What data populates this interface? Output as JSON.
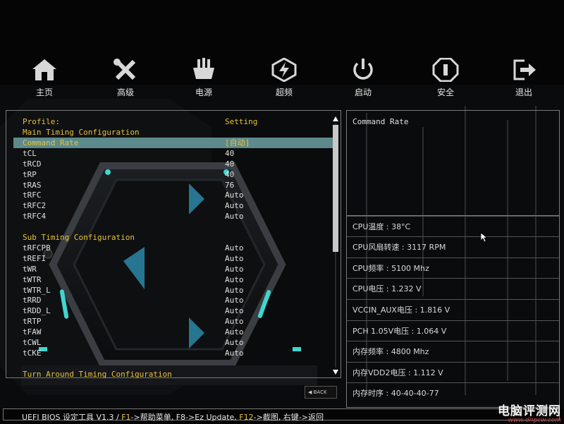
{
  "nav": [
    {
      "label": "主页",
      "icon": "home-icon"
    },
    {
      "label": "高级",
      "icon": "tools-icon"
    },
    {
      "label": "电源",
      "icon": "power-supply-icon"
    },
    {
      "label": "超频",
      "icon": "overclock-icon"
    },
    {
      "label": "启动",
      "icon": "boot-icon"
    },
    {
      "label": "安全",
      "icon": "security-icon"
    },
    {
      "label": "退出",
      "icon": "exit-icon"
    }
  ],
  "timing": {
    "profile_label": "Profile:",
    "profile_value": "Setting",
    "rows": [
      {
        "k": "Main Timing Configuration",
        "v": "",
        "type": "section"
      },
      {
        "k": "Command Rate",
        "v": "[自动]",
        "type": "selected"
      },
      {
        "k": "tCL",
        "v": "40",
        "type": "item"
      },
      {
        "k": "tRCD",
        "v": "40",
        "type": "item"
      },
      {
        "k": "tRP",
        "v": "40",
        "type": "item"
      },
      {
        "k": "tRAS",
        "v": "76",
        "type": "item"
      },
      {
        "k": "tRFC",
        "v": "Auto",
        "type": "item"
      },
      {
        "k": "tRFC2",
        "v": "Auto",
        "type": "item"
      },
      {
        "k": "tRFC4",
        "v": "Auto",
        "type": "item"
      },
      {
        "k": "",
        "v": "",
        "type": "blank"
      },
      {
        "k": "Sub Timing Configuration",
        "v": "",
        "type": "section"
      },
      {
        "k": "tRFCPB",
        "v": "Auto",
        "type": "item"
      },
      {
        "k": "tREFI",
        "v": "Auto",
        "type": "item"
      },
      {
        "k": "tWR",
        "v": "Auto",
        "type": "item"
      },
      {
        "k": "tWTR",
        "v": "Auto",
        "type": "item"
      },
      {
        "k": "tWTR_L",
        "v": "Auto",
        "type": "item"
      },
      {
        "k": "tRRD",
        "v": "Auto",
        "type": "item"
      },
      {
        "k": "tRDD_L",
        "v": "Auto",
        "type": "item"
      },
      {
        "k": "tRTP",
        "v": "Auto",
        "type": "item"
      },
      {
        "k": "tFAW",
        "v": "Auto",
        "type": "item"
      },
      {
        "k": "tCWL",
        "v": "Auto",
        "type": "item"
      },
      {
        "k": "tCKE",
        "v": "Auto",
        "type": "item"
      },
      {
        "k": "",
        "v": "",
        "type": "blank"
      },
      {
        "k": "Turn Around Timing Configuration",
        "v": "",
        "type": "section"
      }
    ],
    "back_label": "BACK"
  },
  "help": {
    "text": "Command Rate"
  },
  "hardware": [
    "CPU温度 : 38°C",
    "CPU风扇转速 : 3117 RPM",
    "CPU频率 : 5100 Mhz",
    "CPU电压 : 1.232 V",
    "VCCIN_AUX电压 : 1.816 V",
    "PCH 1.05V电压 : 1.064 V",
    "内存频率 : 4800 Mhz",
    "内存VDD2电压 : 1.112 V",
    "内存时序 : 40-40-40-77"
  ],
  "status": {
    "prefix": "UEFI BIOS 设定工具 V1.3 / ",
    "f1": "F1",
    "f1_text": "->帮助菜单, F8->Ez Update, ",
    "f12": "F12",
    "f12_text": "->截图, 右键->返回"
  },
  "watermark": {
    "main": "电脑评测网",
    "sub": "www.dnpcw.com"
  },
  "colors": {
    "accent": "#e8c23a",
    "selected": "#5d8a8c",
    "border": "#7a7a7a",
    "glow": "#3fd6d0"
  }
}
